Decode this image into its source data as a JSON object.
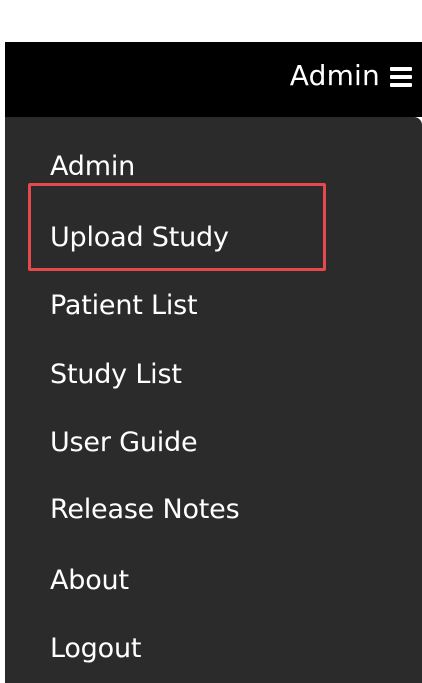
{
  "header": {
    "user_label": "Admin",
    "menu_icon": "hamburger-icon"
  },
  "menu": {
    "items": [
      {
        "label": "Admin"
      },
      {
        "label": "Upload Study"
      },
      {
        "label": "Patient List"
      },
      {
        "label": "Study List"
      },
      {
        "label": "User Guide"
      },
      {
        "label": "Release Notes"
      },
      {
        "label": "About"
      },
      {
        "label": "Logout"
      }
    ]
  },
  "colors": {
    "topbar": "#000000",
    "menu_bg": "#2b2b2b",
    "text": "#ffffff",
    "highlight_border": "#e5484d"
  }
}
